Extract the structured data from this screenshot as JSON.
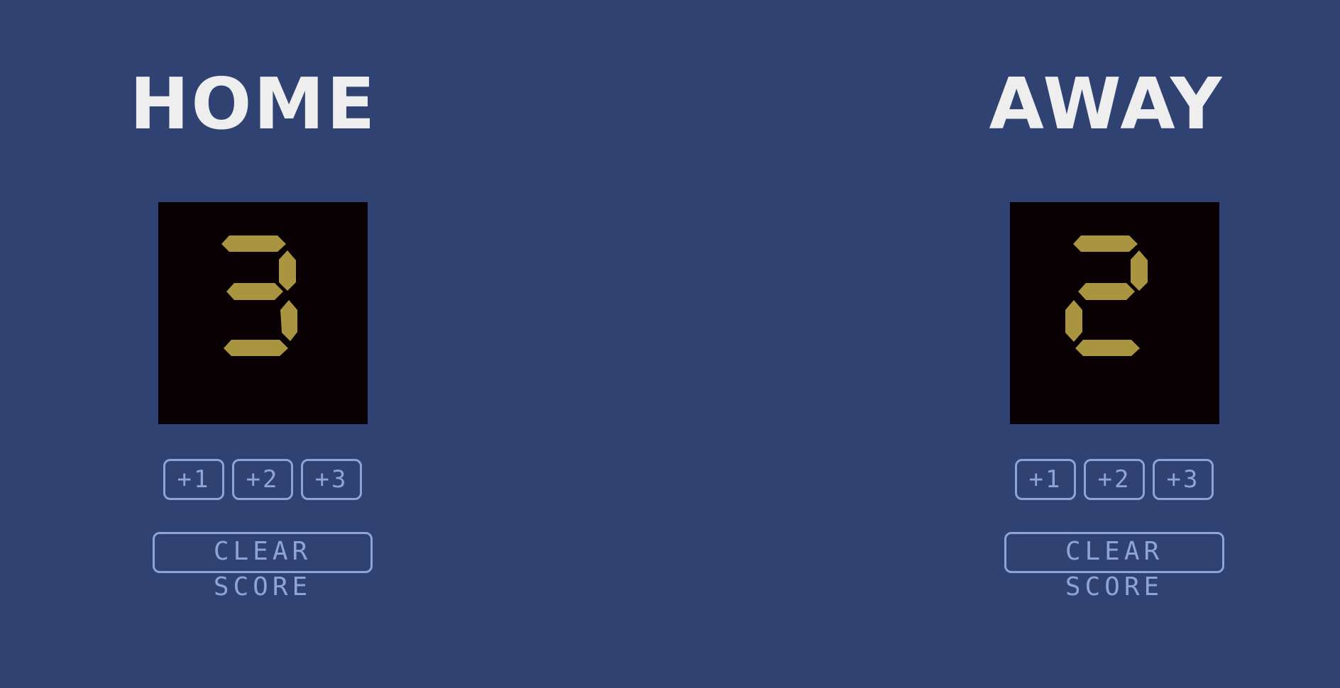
{
  "teams": {
    "home": {
      "name": "HOME",
      "score": 3,
      "add_buttons": [
        "+1",
        "+2",
        "+3"
      ],
      "clear_label": "CLEAR SCORE"
    },
    "away": {
      "name": "AWAY",
      "score": 2,
      "add_buttons": [
        "+1",
        "+2",
        "+3"
      ],
      "clear_label": "CLEAR SCORE"
    }
  },
  "colors": {
    "background": "#2f4271",
    "display_background": "#080002",
    "digit_on": "#a99440",
    "button_outline": "#8fa3d8",
    "title_text": "#eeeeee"
  }
}
